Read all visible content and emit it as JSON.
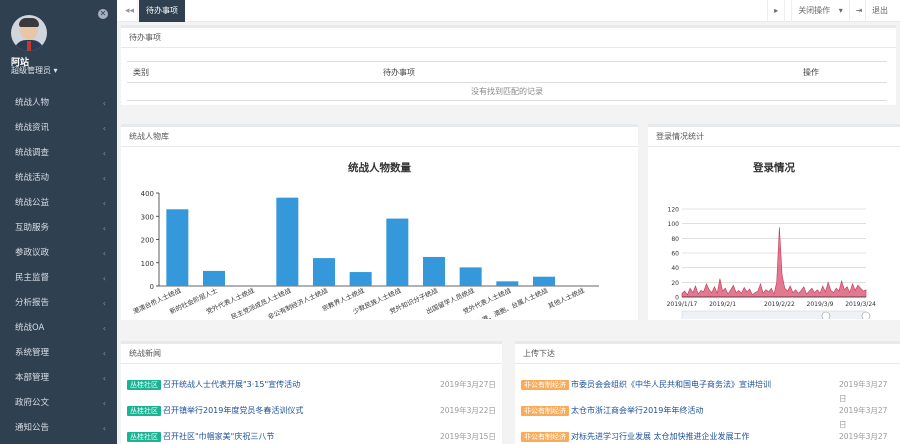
{
  "sidebar": {
    "user_name": "阿站",
    "user_role": "超级管理员",
    "items": [
      {
        "label": "统战人物"
      },
      {
        "label": "统战资讯"
      },
      {
        "label": "统战调查"
      },
      {
        "label": "统战活动"
      },
      {
        "label": "统战公益"
      },
      {
        "label": "互助服务"
      },
      {
        "label": "参政议政"
      },
      {
        "label": "民主监督"
      },
      {
        "label": "分析报告"
      },
      {
        "label": "统战OA"
      },
      {
        "label": "系统管理"
      },
      {
        "label": "本部管理"
      },
      {
        "label": "政府公文"
      },
      {
        "label": "通知公告"
      }
    ],
    "chevron": "‹"
  },
  "topbar": {
    "back": "◂◂",
    "active_tab": "待办事项",
    "close_ops": "关闭操作",
    "exit": "退出"
  },
  "todo": {
    "title": "待办事项",
    "columns": [
      "类别",
      "待办事项",
      "操作"
    ],
    "empty_text": "没有找到匹配的记录"
  },
  "people_panel": {
    "title": "统战人物库"
  },
  "login_panel": {
    "title": "登录情况统计"
  },
  "chart_data": [
    {
      "type": "bar",
      "title": "统战人物数量",
      "categories": [
        "港澳台侨人士统战",
        "新的社会阶层人士",
        "党外代表人士统战",
        "民主党派成员人士统战",
        "非公有制经济人士统战",
        "宗教界人士统战",
        "少数民族人士统战",
        "党外知识分子统战",
        "出国留学人员统战",
        "党外代表人士统战",
        "台港、澳胞、台属人士统战",
        "其他人士统战"
      ],
      "values": [
        330,
        65,
        0,
        380,
        120,
        60,
        290,
        125,
        80,
        20,
        40,
        0
      ],
      "ylim": [
        0,
        400
      ],
      "yticks": [
        0,
        100,
        200,
        300,
        400
      ],
      "color": "#3498db"
    },
    {
      "type": "area",
      "title": "登录情况",
      "x": [
        "2019/1/17",
        "2019/1/18",
        "2019/1/19",
        "2019/1/20",
        "2019/1/21",
        "2019/1/22",
        "2019/1/23",
        "2019/1/24",
        "2019/1/25",
        "2019/1/26",
        "2019/1/27",
        "2019/1/28",
        "2019/1/29",
        "2019/1/30",
        "2019/1/31",
        "2019/2/1",
        "2019/2/2",
        "2019/2/3",
        "2019/2/4",
        "2019/2/5",
        "2019/2/6",
        "2019/2/7",
        "2019/2/8",
        "2019/2/9",
        "2019/2/10",
        "2019/2/11",
        "2019/2/12",
        "2019/2/13",
        "2019/2/14",
        "2019/2/15",
        "2019/2/16",
        "2019/2/17",
        "2019/2/18",
        "2019/2/19",
        "2019/2/20",
        "2019/2/21",
        "2019/2/22",
        "2019/2/23",
        "2019/2/24",
        "2019/2/25",
        "2019/2/26",
        "2019/2/27",
        "2019/2/28",
        "2019/3/1",
        "2019/3/2",
        "2019/3/3",
        "2019/3/4",
        "2019/3/5",
        "2019/3/6",
        "2019/3/7",
        "2019/3/8",
        "2019/3/9",
        "2019/3/10",
        "2019/3/11",
        "2019/3/12",
        "2019/3/13",
        "2019/3/14",
        "2019/3/15",
        "2019/3/16",
        "2019/3/17",
        "2019/3/18",
        "2019/3/19",
        "2019/3/20",
        "2019/3/21",
        "2019/3/22",
        "2019/3/23",
        "2019/3/24",
        "2019/3/25",
        "2019/3/26"
      ],
      "values": [
        5,
        8,
        3,
        12,
        6,
        15,
        4,
        9,
        7,
        18,
        10,
        6,
        14,
        5,
        25,
        8,
        12,
        4,
        10,
        16,
        6,
        9,
        5,
        13,
        7,
        11,
        3,
        6,
        8,
        18,
        5,
        10,
        7,
        12,
        4,
        20,
        95,
        30,
        12,
        8,
        15,
        6,
        10,
        5,
        9,
        14,
        4,
        8,
        12,
        6,
        10,
        5,
        15,
        7,
        20,
        9,
        6,
        12,
        8,
        22,
        10,
        14,
        6,
        18,
        9,
        16,
        12,
        8,
        10
      ],
      "ylim": [
        0,
        120
      ],
      "yticks": [
        0,
        20,
        40,
        60,
        80,
        100,
        120
      ],
      "xticks": [
        "2019/1/17",
        "2019/2/1",
        "2019/2/22",
        "2019/3/9",
        "2019/3/24"
      ],
      "color": "#e0607e"
    }
  ],
  "news": {
    "title": "统战新闻",
    "items": [
      {
        "badge": "丛桂社区",
        "text": "召开统战人士代表开展\"3·15\"宣传活动",
        "date": "2019年3月27日"
      },
      {
        "badge": "丛桂社区",
        "text": "召开镇举行2019年度党员冬春活训仪式",
        "date": "2019年3月22日"
      },
      {
        "badge": "丛桂社区",
        "text": "召开社区\"巾帼家美\"庆祝三八节",
        "date": "2019年3月15日"
      }
    ]
  },
  "notice": {
    "title": "上传下达",
    "items": [
      {
        "badge": "非公有制经济",
        "text": "市委员会会组织《中华人民共和国电子商务法》宣讲培训",
        "date": "2019年3月27日"
      },
      {
        "badge": "非公有制经济",
        "text": "太仓市浙江商会举行2019年年终活动",
        "date": "2019年3月27日"
      },
      {
        "badge": "非公有制经济",
        "text": "对标先进学习行业发展 太仓加快推进企业发展工作",
        "date": "2019年3月27日"
      }
    ]
  }
}
